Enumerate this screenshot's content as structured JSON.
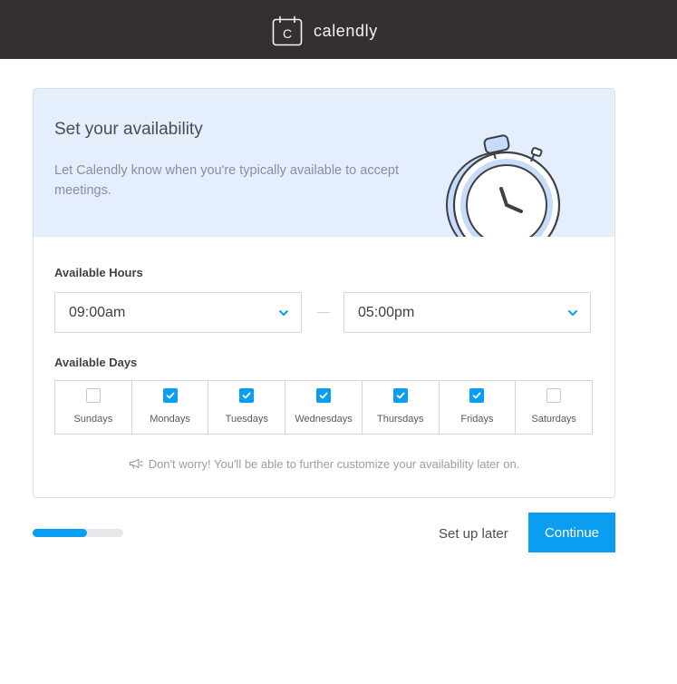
{
  "header": {
    "brand_name": "calendly",
    "brand_letter": "C",
    "background": "#362f30"
  },
  "card": {
    "title": "Set your availability",
    "description": "Let Calendly know when you're typically available to accept meetings.",
    "hero_background": "#e4eefc",
    "illustration": "stopwatch-icon",
    "available_hours_label": "Available Hours",
    "start_time": "09:00am",
    "end_time": "05:00pm",
    "available_days_label": "Available Days",
    "days": [
      {
        "label": "Sundays",
        "checked": false
      },
      {
        "label": "Mondays",
        "checked": true
      },
      {
        "label": "Tuesdays",
        "checked": true
      },
      {
        "label": "Wednesdays",
        "checked": true
      },
      {
        "label": "Thursdays",
        "checked": true
      },
      {
        "label": "Fridays",
        "checked": true
      },
      {
        "label": "Saturdays",
        "checked": false
      }
    ],
    "note": "Don't worry! You'll be able to further customize your availability later on.",
    "note_icon": "megaphone-icon"
  },
  "footer": {
    "progress": 0.6,
    "set_up_later_label": "Set up later",
    "continue_label": "Continue"
  },
  "colors": {
    "accent": "#0a9df0",
    "text": "#4a4d52",
    "muted": "#8a8f98"
  }
}
